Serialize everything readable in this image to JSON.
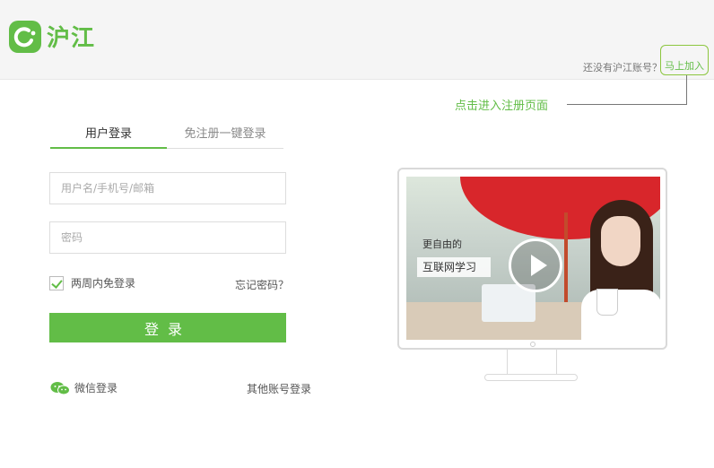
{
  "brand": {
    "name": "沪江",
    "color": "#62bd47"
  },
  "header": {
    "signup_prompt": "还没有沪江账号？",
    "signup_link": "马上加入"
  },
  "annotation": {
    "callout_text": "点击进入注册页面"
  },
  "login": {
    "tabs": [
      {
        "label": "用户登录",
        "active": true
      },
      {
        "label": "免注册一键登录",
        "active": false
      }
    ],
    "username_placeholder": "用户名/手机号/邮箱",
    "password_placeholder": "密码",
    "remember_label": "两周内免登录",
    "remember_checked": true,
    "forgot_label": "忘记密码？",
    "submit_label": "登录",
    "wechat_label": "微信登录",
    "other_label": "其他账号登录"
  },
  "promo": {
    "caption_line1": "更自由的",
    "caption_line2": "互联网学习",
    "icons": [
      "play-icon",
      "wechat-icon"
    ]
  }
}
